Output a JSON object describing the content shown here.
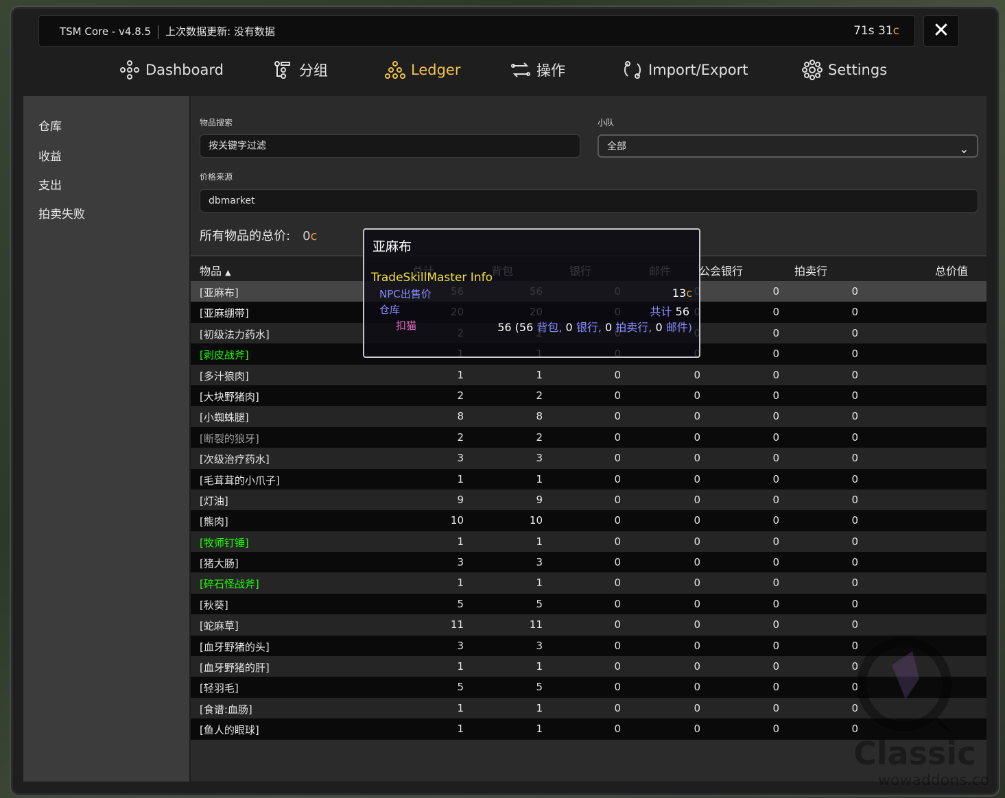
{
  "window": {
    "title": "TSM Core - v4.8.5",
    "last_update": "上次数据更新: 没有数据",
    "timer": "71s 31",
    "timer_unit": "c",
    "close_symbol": "✕"
  },
  "nav": [
    {
      "label": "Dashboard",
      "icon": "dashboard-icon"
    },
    {
      "label": "分组",
      "icon": "groups-icon"
    },
    {
      "label": "Ledger",
      "icon": "ledger-icon"
    },
    {
      "label": "操作",
      "icon": "operations-icon"
    },
    {
      "label": "Import/Export",
      "icon": "import-export-icon"
    },
    {
      "label": "Settings",
      "icon": "settings-icon"
    }
  ],
  "sidebar": [
    "仓库",
    "收益",
    "支出",
    "拍卖失败"
  ],
  "filters": {
    "search_label": "物品搜索",
    "search_placeholder": "按关键字过滤",
    "group_label": "小队",
    "group_value": "全部",
    "price_label": "价格来源",
    "price_value": "dbmarket"
  },
  "total": {
    "label": "所有物品的总价:",
    "value": "0",
    "unit": "c"
  },
  "table": {
    "headers": [
      "物品",
      "总计",
      "背包",
      "银行",
      "邮件",
      "公会银行",
      "拍卖行",
      "总价值"
    ],
    "rows": [
      {
        "name": "[亚麻布]",
        "color": "#e6e6e6",
        "v": [
          "56",
          "56",
          "0",
          "0",
          "0",
          "0"
        ]
      },
      {
        "name": "[亚麻绷带]",
        "color": "#e6e6e6",
        "v": [
          "20",
          "20",
          "0",
          "0",
          "0",
          "0"
        ]
      },
      {
        "name": "[初级法力药水]",
        "color": "#e6e6e6",
        "v": [
          "2",
          "2",
          "0",
          "0",
          "0",
          "0"
        ]
      },
      {
        "name": "[剥皮战斧]",
        "color": "#1eff00",
        "v": [
          "1",
          "1",
          "0",
          "0",
          "0",
          "0"
        ]
      },
      {
        "name": "[多汁狼肉]",
        "color": "#e6e6e6",
        "v": [
          "1",
          "1",
          "0",
          "0",
          "0",
          "0"
        ]
      },
      {
        "name": "[大块野猪肉]",
        "color": "#e6e6e6",
        "v": [
          "2",
          "2",
          "0",
          "0",
          "0",
          "0"
        ]
      },
      {
        "name": "[小蜘蛛腿]",
        "color": "#e6e6e6",
        "v": [
          "8",
          "8",
          "0",
          "0",
          "0",
          "0"
        ]
      },
      {
        "name": "[断裂的狼牙]",
        "color": "#9d9d9d",
        "v": [
          "2",
          "2",
          "0",
          "0",
          "0",
          "0"
        ]
      },
      {
        "name": "[次级治疗药水]",
        "color": "#e6e6e6",
        "v": [
          "3",
          "3",
          "0",
          "0",
          "0",
          "0"
        ]
      },
      {
        "name": "[毛茸茸的小爪子]",
        "color": "#e6e6e6",
        "v": [
          "1",
          "1",
          "0",
          "0",
          "0",
          "0"
        ]
      },
      {
        "name": "[灯油]",
        "color": "#e6e6e6",
        "v": [
          "9",
          "9",
          "0",
          "0",
          "0",
          "0"
        ]
      },
      {
        "name": "[熊肉]",
        "color": "#e6e6e6",
        "v": [
          "10",
          "10",
          "0",
          "0",
          "0",
          "0"
        ]
      },
      {
        "name": "[牧师钉锤]",
        "color": "#1eff00",
        "v": [
          "1",
          "1",
          "0",
          "0",
          "0",
          "0"
        ]
      },
      {
        "name": "[猪大肠]",
        "color": "#e6e6e6",
        "v": [
          "3",
          "3",
          "0",
          "0",
          "0",
          "0"
        ]
      },
      {
        "name": "[碎石怪战斧]",
        "color": "#1eff00",
        "v": [
          "1",
          "1",
          "0",
          "0",
          "0",
          "0"
        ]
      },
      {
        "name": "[秋葵]",
        "color": "#e6e6e6",
        "v": [
          "5",
          "5",
          "0",
          "0",
          "0",
          "0"
        ]
      },
      {
        "name": "[蛇麻草]",
        "color": "#e6e6e6",
        "v": [
          "11",
          "11",
          "0",
          "0",
          "0",
          "0"
        ]
      },
      {
        "name": "[血牙野猪的头]",
        "color": "#e6e6e6",
        "v": [
          "3",
          "3",
          "0",
          "0",
          "0",
          "0"
        ]
      },
      {
        "name": "[血牙野猪的肝]",
        "color": "#e6e6e6",
        "v": [
          "1",
          "1",
          "0",
          "0",
          "0",
          "0"
        ]
      },
      {
        "name": "[轻羽毛]",
        "color": "#e6e6e6",
        "v": [
          "5",
          "5",
          "0",
          "0",
          "0",
          "0"
        ]
      },
      {
        "name": "[食谱:血肠]",
        "color": "#e6e6e6",
        "v": [
          "1",
          "1",
          "0",
          "0",
          "0",
          "0"
        ]
      },
      {
        "name": "[鱼人的眼球]",
        "color": "#e6e6e6",
        "v": [
          "1",
          "1",
          "0",
          "0",
          "0",
          "0"
        ]
      }
    ]
  },
  "tooltip": {
    "title": "亚麻布",
    "header": "TradeSkillMaster Info",
    "vendor_label": "NPC出售价",
    "vendor_value": "13",
    "vendor_unit": "c",
    "warehouse_label": "仓库",
    "total_label": "共计",
    "total_value": "56",
    "char_label": "扣猫",
    "char_count": "56",
    "char_bags": "56",
    "bags_word": "背包,",
    "char_bank": "0",
    "bank_word": "银行,",
    "char_ah": "0",
    "ah_word": "拍卖行,",
    "char_mail": "0",
    "mail_word": "邮件)"
  },
  "watermark": {
    "text": "Classic",
    "subtext": "wowaddons.com"
  },
  "colors": {
    "accent": "#f2c14e",
    "uncommon": "#1eff00",
    "poor": "#9d9d9d",
    "copper": "#e39b3b",
    "tooltip_label": "#8a8aff"
  }
}
